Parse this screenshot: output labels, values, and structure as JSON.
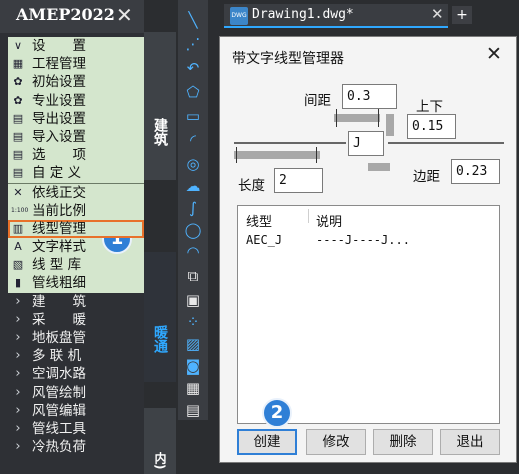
{
  "app": {
    "title": "AMEP2022",
    "close_glyph": "✕"
  },
  "menu": {
    "settings_section": "设　　置",
    "settings_items": [
      {
        "label": "工程管理",
        "icon": "project-icon",
        "glyph": "▦"
      },
      {
        "label": "初始设置",
        "icon": "gear-icon",
        "glyph": "✿"
      },
      {
        "label": "专业设置",
        "icon": "gear-icon",
        "glyph": "✿"
      },
      {
        "label": "导出设置",
        "icon": "export-icon",
        "glyph": "▤"
      },
      {
        "label": "导入设置",
        "icon": "import-icon",
        "glyph": "▤"
      },
      {
        "label": "选　　项",
        "icon": "options-icon",
        "glyph": "▤"
      },
      {
        "label": "自 定 义",
        "icon": "custom-icon",
        "glyph": "▤"
      }
    ],
    "tool_items": [
      {
        "label": "依线正交",
        "icon": "orthogonal-icon",
        "glyph": "✕"
      },
      {
        "label": "当前比例",
        "icon": "scale-icon",
        "glyph": "1:100"
      },
      {
        "label": "线型管理",
        "icon": "linetype-icon",
        "glyph": "▥"
      },
      {
        "label": "文字样式",
        "icon": "textstyle-icon",
        "glyph": "A"
      },
      {
        "label": "线 型 库",
        "icon": "linelib-icon",
        "glyph": "▧"
      },
      {
        "label": "管线粗细",
        "icon": "pipewidth-icon",
        "glyph": "▮"
      }
    ],
    "dark_items": [
      {
        "label": "建　　筑"
      },
      {
        "label": "采　　暖"
      },
      {
        "label": "地板盘管"
      },
      {
        "label": "多 联 机"
      },
      {
        "label": "空调水路"
      },
      {
        "label": "风管绘制"
      },
      {
        "label": "风管编辑"
      },
      {
        "label": "管线工具"
      },
      {
        "label": "冷热负荷"
      }
    ],
    "expand_glyph": "›",
    "collapse_glyph": "∨"
  },
  "vtabs": {
    "architecture": "建筑",
    "hvac": "暖通",
    "bottom": "内)"
  },
  "doc_tab": {
    "icon_text": "DWG",
    "name": "Drawing1.dwg*",
    "close": "✕",
    "new": "+"
  },
  "dialog": {
    "title": "带文字线型管理器",
    "close": "✕",
    "spacing_label": "间距",
    "spacing_value": "0.3",
    "updown_label": "上下",
    "updown_value": "0.15",
    "text_value": "J",
    "length_label": "长度",
    "length_value": "2",
    "margin_label": "边距",
    "margin_value": "0.23",
    "list": {
      "col_linetype": "线型",
      "col_desc": "说明",
      "rows": [
        {
          "name": "AEC_J",
          "desc": "----J----J..."
        }
      ]
    },
    "buttons": {
      "create": "创建",
      "modify": "修改",
      "delete": "删除",
      "exit": "退出"
    }
  },
  "badges": {
    "step1": "1",
    "step2": "2"
  },
  "colors": {
    "accent": "#2f7fd6",
    "highlight": "#e8712a",
    "menu_green": "#d4e6cd",
    "tool_blue": "#4fb3ff"
  }
}
